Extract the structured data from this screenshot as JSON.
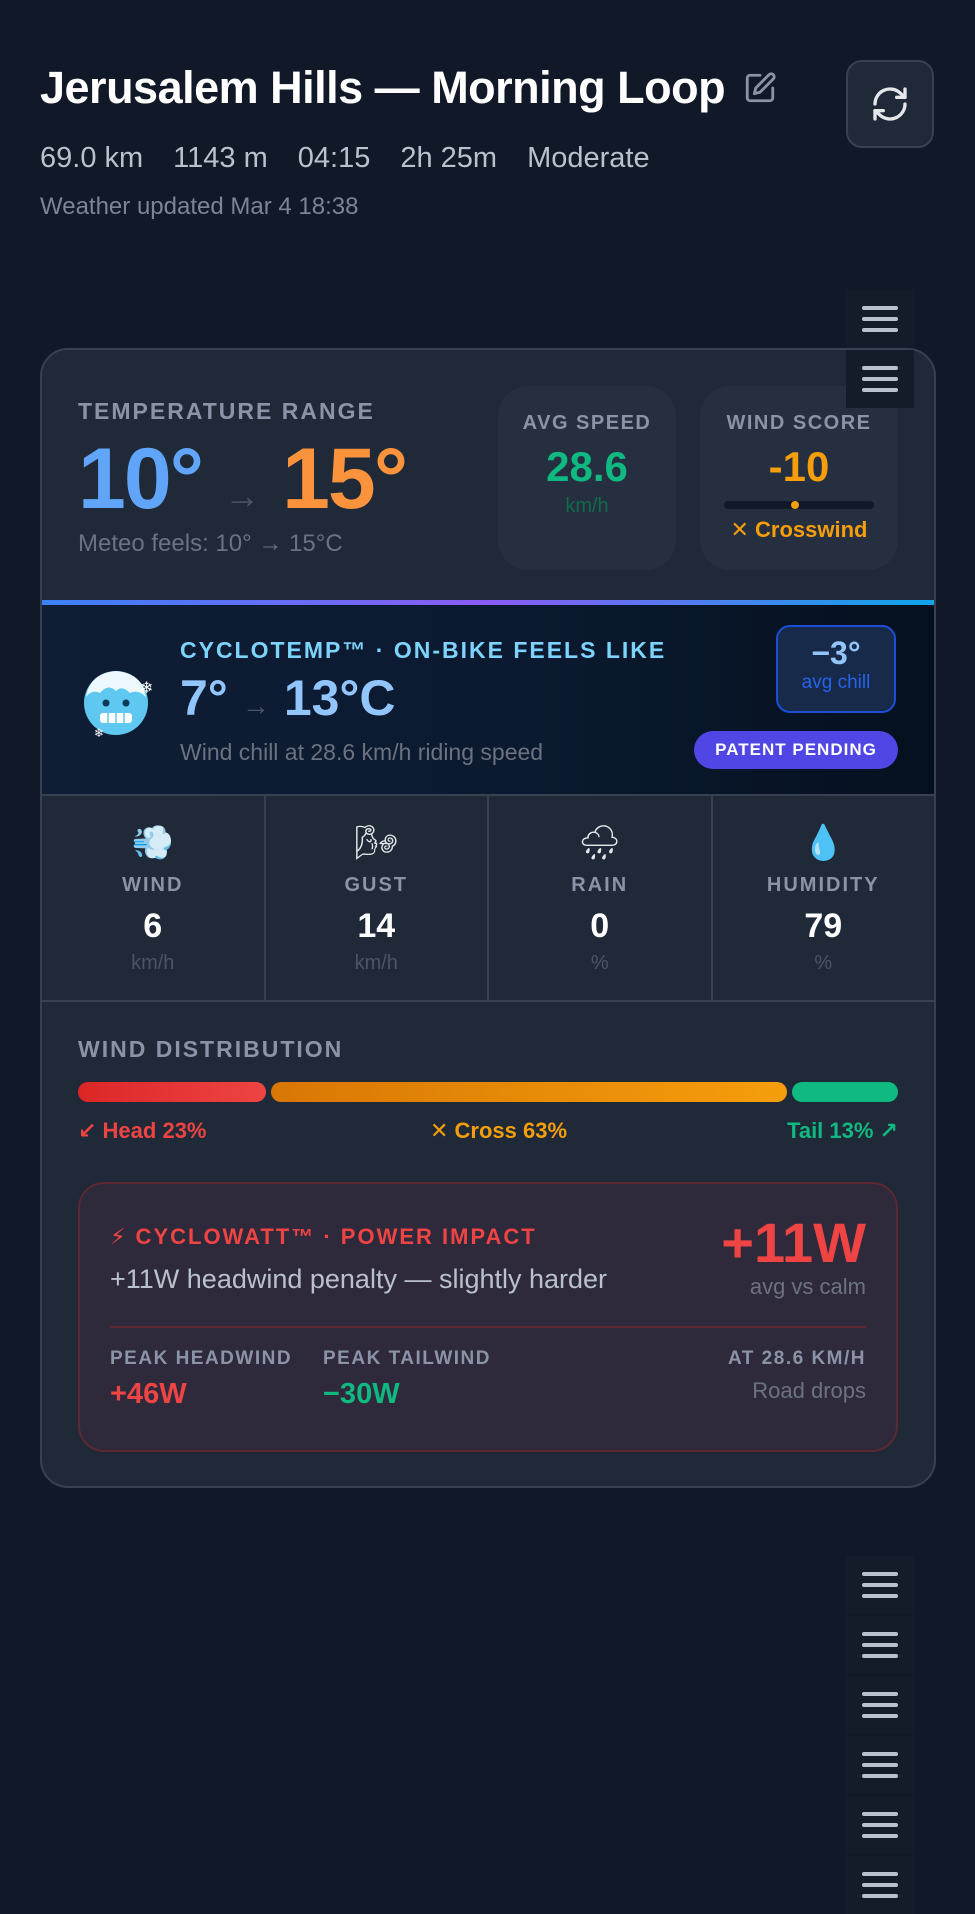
{
  "header": {
    "title": "Jerusalem Hills — Morning Loop",
    "stats": [
      "69.0 km",
      "1143 m",
      "04:15",
      "2h 25m",
      "Moderate"
    ],
    "updated": "Weather updated Mar 4 18:38"
  },
  "temperature": {
    "label": "TEMPERATURE RANGE",
    "low": "10°",
    "arrow": "→",
    "high": "15°",
    "meteo": "Meteo feels: 10° → 15°C"
  },
  "avg_speed": {
    "label": "AVG SPEED",
    "value": "28.6",
    "unit": "km/h"
  },
  "wind_score": {
    "label": "WIND SCORE",
    "value": "-10",
    "status": "✕ Crosswind",
    "level": 0.47
  },
  "cyclotemp": {
    "label": "CYCLOTEMP™ · ON-BIKE FEELS LIKE",
    "low": "7°",
    "arrow": "→",
    "high": "13°C",
    "subtitle": "Wind chill at 28.6 km/h riding speed",
    "chill_value": "−3°",
    "chill_label": "avg chill",
    "patent": "PATENT PENDING"
  },
  "metrics": [
    {
      "icon": "wind-icon",
      "glyph": "💨",
      "label": "WIND",
      "value": "6",
      "unit": "km/h"
    },
    {
      "icon": "gust-icon",
      "glyph": "🌬",
      "label": "GUST",
      "value": "14",
      "unit": "km/h"
    },
    {
      "icon": "rain-icon",
      "glyph": "🌧",
      "label": "RAIN",
      "value": "0",
      "unit": "%"
    },
    {
      "icon": "humidity-icon",
      "glyph": "💧",
      "label": "HUMIDITY",
      "value": "79",
      "unit": "%"
    }
  ],
  "wind_distribution": {
    "label": "WIND DISTRIBUTION",
    "head_pct": 23,
    "cross_pct": 63,
    "tail_pct": 13,
    "head_label": "↙ Head 23%",
    "cross_label": "✕ Cross 63%",
    "tail_label": "Tail 13% ↗",
    "colors": {
      "head": "#ef4444",
      "cross": "#f59e0b",
      "tail": "#10b981"
    }
  },
  "cyclowatt": {
    "label": "⚡ CYCLOWATT™ · POWER IMPACT",
    "description": "+11W headwind penalty — slightly harder",
    "value": "+11W",
    "value_sub": "avg vs calm",
    "peak_head_label": "PEAK HEADWIND",
    "peak_head_value": "+46W",
    "peak_tail_label": "PEAK TAILWIND",
    "peak_tail_value": "−30W",
    "speed_label": "AT 28.6 KM/H",
    "position": "Road drops"
  },
  "colors": {
    "background": "#111827",
    "card": "#1f2937",
    "cold": "#60a5fa",
    "warm": "#fb923c",
    "speed": "#10b981",
    "accent": "#4f46e5",
    "danger": "#ef4444"
  }
}
